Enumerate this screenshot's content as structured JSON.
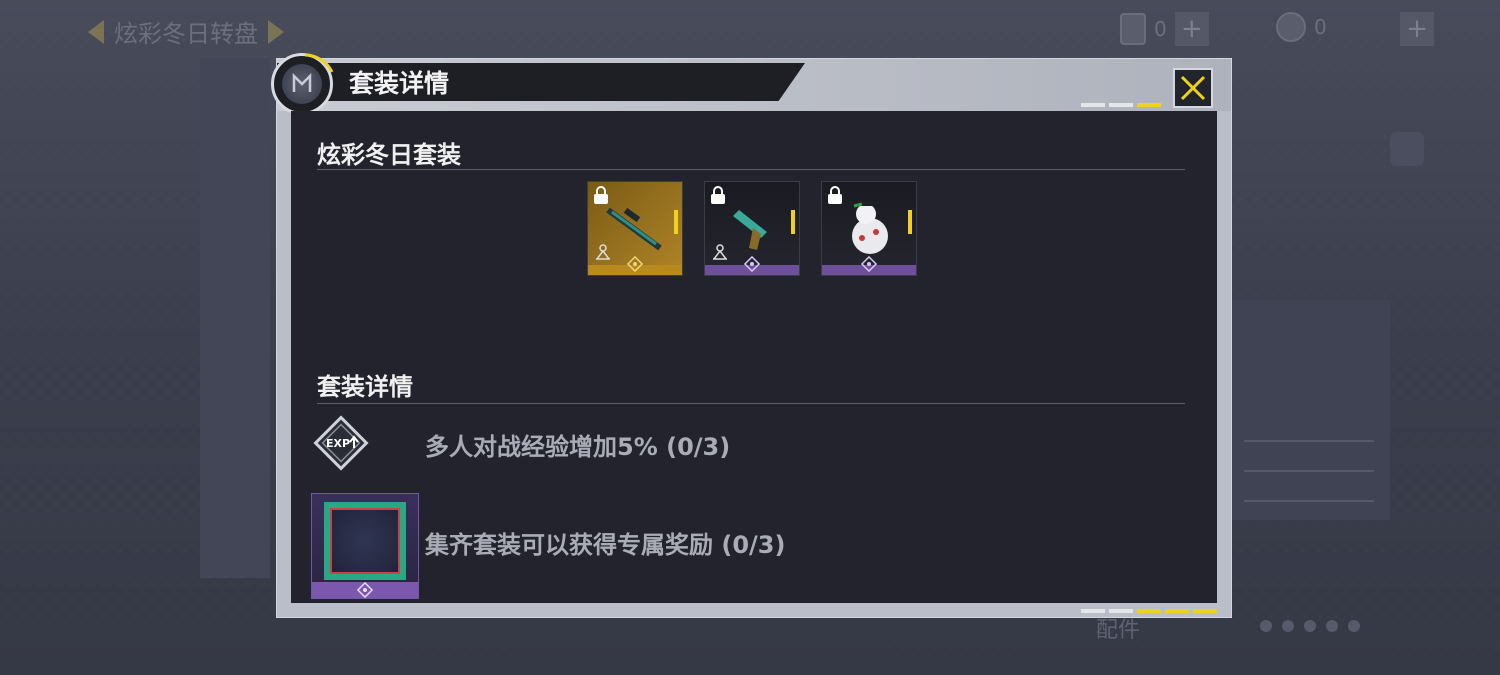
{
  "background": {
    "event_title": "炫彩冬日转盘",
    "currency_1": "0",
    "currency_2": "0",
    "bottom_label": "配件"
  },
  "modal": {
    "title": "套装详情",
    "close_icon": "close-x-icon",
    "accent_color": "#f0d21c"
  },
  "set": {
    "name": "炫彩冬日套装",
    "items": [
      {
        "name": "sniper-rifle-skin",
        "rarity": "gold",
        "locked": true
      },
      {
        "name": "pistol-skin",
        "rarity": "purple",
        "locked": true
      },
      {
        "name": "snowman-grenade-skin",
        "rarity": "purple",
        "locked": true
      }
    ]
  },
  "details": {
    "heading": "套装详情",
    "bonus_text": "多人对战经验增加5% (0/3)",
    "reward_text": "集齐套装可以获得专属奖励 (0/3)"
  }
}
